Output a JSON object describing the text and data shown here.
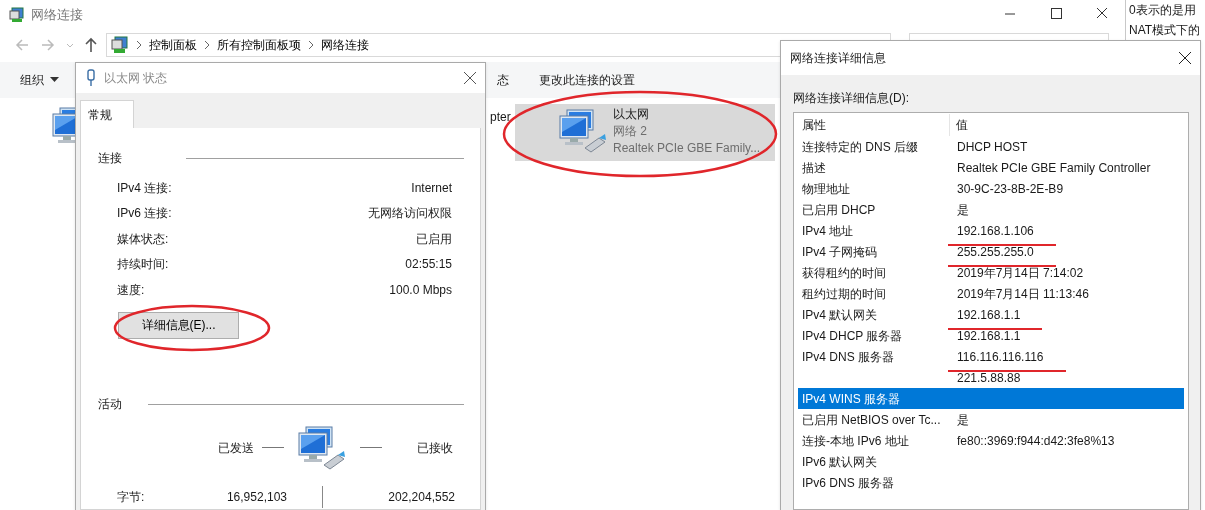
{
  "explorer": {
    "title": "网络连接",
    "breadcrumb": [
      "控制面板",
      "所有控制面板项",
      "网络连接"
    ],
    "toolbar": [
      {
        "kind": "menu",
        "label": "组织"
      },
      {
        "kind": "plain",
        "label": "态"
      },
      {
        "kind": "plain",
        "label": "更改此连接的设置"
      }
    ],
    "partial_label": "pter",
    "adapter": {
      "name": "以太网",
      "network": "网络 2",
      "device": "Realtek PCIe GBE Family...",
      "selected": true,
      "circled": true
    }
  },
  "background_doc": {
    "lines": [
      "0表示的是用",
      "NAT模式下的"
    ]
  },
  "status_dialog": {
    "title": "以太网 状态",
    "tabs": [
      {
        "label": "常规",
        "selected": true
      }
    ],
    "connection": {
      "heading": "连接",
      "rows": [
        {
          "label": "IPv4 连接:",
          "value": "Internet"
        },
        {
          "label": "IPv6 连接:",
          "value": "无网络访问权限"
        },
        {
          "label": "媒体状态:",
          "value": "已启用"
        },
        {
          "label": "持续时间:",
          "value": "02:55:15"
        },
        {
          "label": "速度:",
          "value": "100.0 Mbps"
        }
      ],
      "details_button": {
        "label": "详细信息(E)...",
        "circled": true
      }
    },
    "activity": {
      "heading": "活动",
      "sent_label": "已发送",
      "received_label": "已接收",
      "bytes_label": "字节:",
      "bytes_sent": "16,952,103",
      "bytes_received": "202,204,552"
    }
  },
  "details_dialog": {
    "title": "网络连接详细信息",
    "list_label": "网络连接详细信息(D):",
    "columns": [
      "属性",
      "值"
    ],
    "rows": [
      {
        "property": "连接特定的 DNS 后缀",
        "value": "DHCP HOST",
        "selected": false,
        "underlined": false
      },
      {
        "property": "描述",
        "value": "Realtek PCIe GBE Family Controller",
        "selected": false,
        "underlined": false
      },
      {
        "property": "物理地址",
        "value": "30-9C-23-8B-2E-B9",
        "selected": false,
        "underlined": false
      },
      {
        "property": "已启用 DHCP",
        "value": "是",
        "selected": false,
        "underlined": false
      },
      {
        "property": "IPv4 地址",
        "value": "192.168.1.106",
        "selected": false,
        "underlined": true
      },
      {
        "property": "IPv4 子网掩码",
        "value": "255.255.255.0",
        "selected": false,
        "underlined": true
      },
      {
        "property": "获得租约的时间",
        "value": "2019年7月14日 7:14:02",
        "selected": false,
        "underlined": false
      },
      {
        "property": "租约过期的时间",
        "value": "2019年7月14日 11:13:46",
        "selected": false,
        "underlined": false
      },
      {
        "property": "IPv4 默认网关",
        "value": "192.168.1.1",
        "selected": false,
        "underlined": true
      },
      {
        "property": "IPv4 DHCP 服务器",
        "value": "192.168.1.1",
        "selected": false,
        "underlined": false
      },
      {
        "property": "IPv4 DNS 服务器",
        "value": "116.116.116.116",
        "selected": false,
        "underlined": true
      },
      {
        "value": "221.5.88.88",
        "selected": false,
        "underlined": false
      },
      {
        "property": "IPv4 WINS 服务器",
        "selected": true,
        "underlined": false
      },
      {
        "property": "已启用 NetBIOS over Tc...",
        "value": "是",
        "selected": false,
        "underlined": false
      },
      {
        "property": "连接-本地 IPv6 地址",
        "value": "fe80::3969:f944:d42:3fe8%13",
        "selected": false,
        "underlined": false
      },
      {
        "property": "IPv6 默认网关",
        "selected": false,
        "underlined": false
      },
      {
        "property": "IPv6 DNS 服务器",
        "selected": false,
        "underlined": false
      }
    ]
  }
}
